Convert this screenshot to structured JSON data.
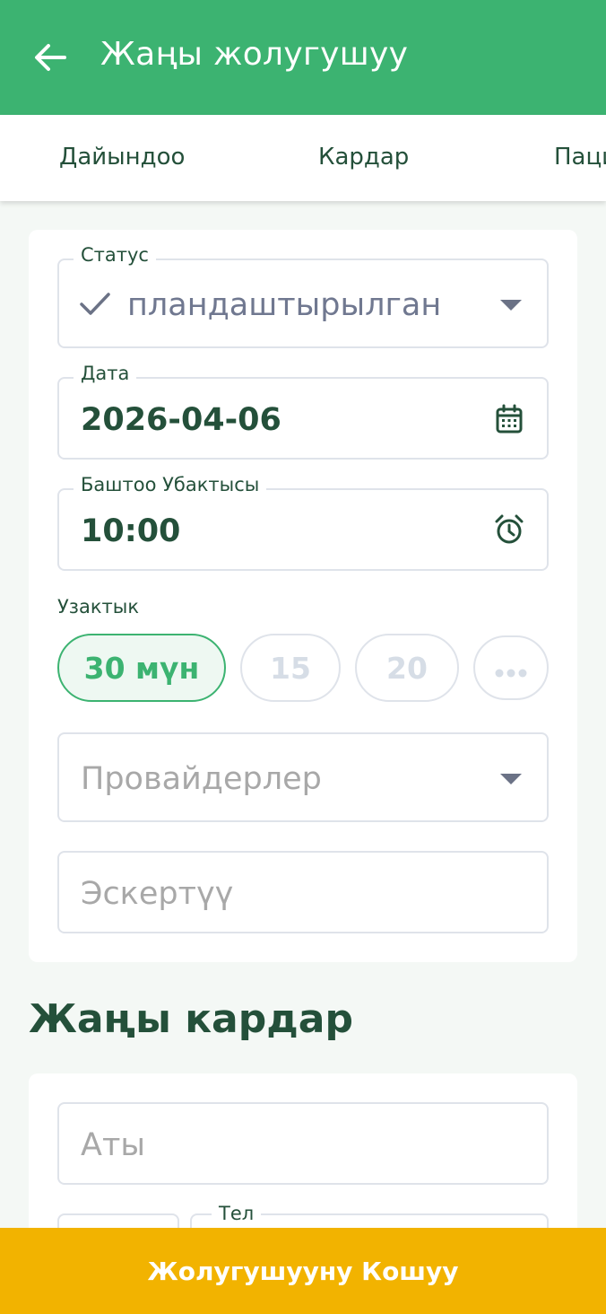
{
  "appbar": {
    "title": "Жаңы жолугушуу",
    "back_icon": "arrow-left-icon",
    "background": "#3cb371"
  },
  "tabs": [
    {
      "label": "Дайындоо"
    },
    {
      "label": "Кардар"
    },
    {
      "label": "Пациент"
    }
  ],
  "appointment": {
    "status": {
      "label": "Статус",
      "value": "пландаштырылган",
      "icon": "check-icon"
    },
    "date": {
      "label": "Дата",
      "value": "2026-04-06",
      "icon": "calendar-icon"
    },
    "start_time": {
      "label": "Баштоо Убактысы",
      "value": "10:00",
      "icon": "alarm-clock-icon"
    },
    "duration": {
      "label": "Узактык",
      "options": [
        "30 мүн",
        "15",
        "20"
      ],
      "selected": "30 мүн",
      "more_icon": "more-horizontal-icon"
    },
    "providers": {
      "placeholder": "Провайдерлер"
    },
    "note": {
      "placeholder": "Эскертүү"
    }
  },
  "new_client": {
    "title": "Жаңы кардар",
    "name": {
      "placeholder": "Аты"
    },
    "phone": {
      "label": "Тел"
    }
  },
  "footer": {
    "button_label": "Жолугушууну Кошуу",
    "color": "#f2b300"
  }
}
